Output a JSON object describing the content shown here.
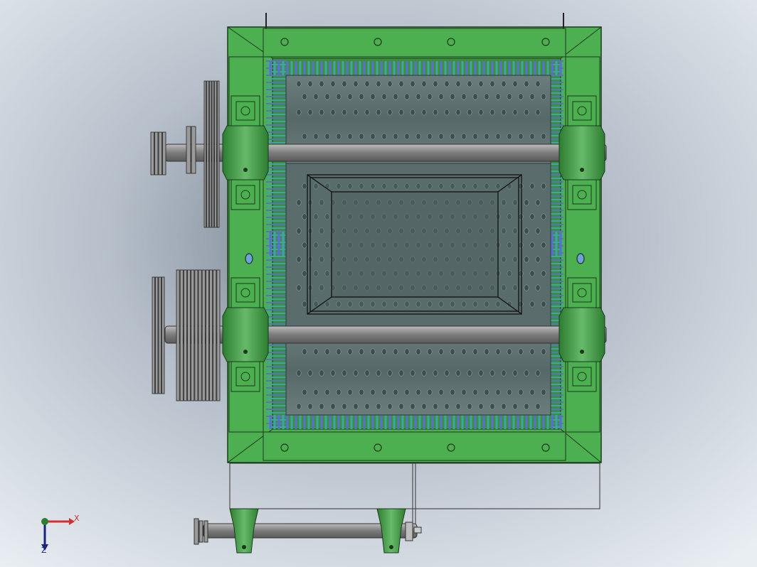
{
  "viewport": {
    "background_top": "#dfe6ee",
    "background_mid": "#a9b2bc",
    "background_bottom": "#e8edf2"
  },
  "colors": {
    "frame_green": "#4caf50",
    "frame_green_dark": "#2e7d32",
    "frame_outline": "#1b3a1b",
    "drum_gray": "#5f7272",
    "tooth_blue": "#5a6fd6",
    "tooth_teal": "#3fa5a0",
    "shaft_gray": "#8a8a8a",
    "pulley_gray": "#9a9a9a",
    "bearing_green": "#43a047"
  },
  "triad": {
    "x_label": "X",
    "z_label": "Z",
    "x_color": "#d32f2f",
    "y_color": "#2e7d32",
    "z_color": "#1a237e"
  },
  "icons": {
    "triad": "axis-triad-icon",
    "origin": "origin-sphere-icon"
  }
}
